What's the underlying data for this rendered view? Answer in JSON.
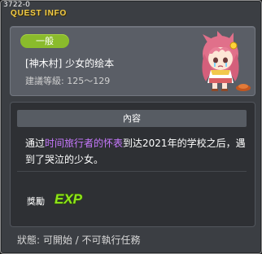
{
  "window": {
    "quest_id": "3722-0",
    "title": "QUEST INFO"
  },
  "quest": {
    "category": "一般",
    "name": "[神木村] 少女的绘本",
    "level": "建議等級: 125〜129",
    "npc_icon": "pink-haired-girl-crying"
  },
  "content": {
    "section_title": "內容",
    "description_prefix": "通过",
    "description_highlight": "时间旅行者的怀表",
    "description_suffix": "到达2021年的学校之后，遇到了哭泣的少女。",
    "highlight_color": "#c879ff"
  },
  "reward": {
    "label": "獎勵",
    "exp_label": "EXP",
    "exp_color": "#8fe31c"
  },
  "status": {
    "text": "狀態: 可開始 / 不可執行任務"
  },
  "colors": {
    "title": "#f4ce47",
    "badge": "#8abb2c"
  }
}
